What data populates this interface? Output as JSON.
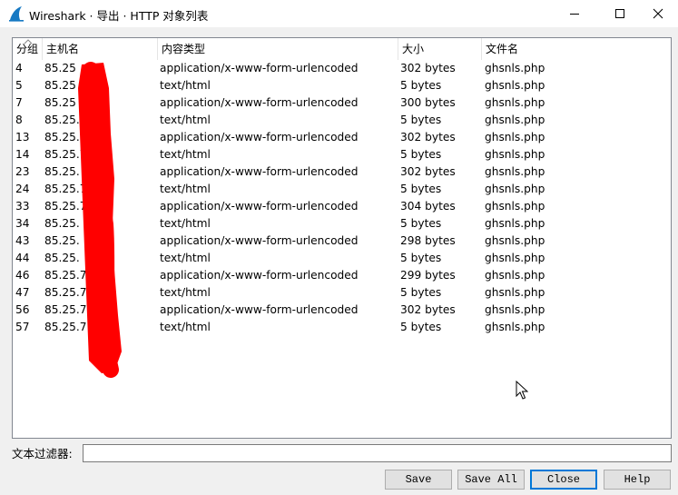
{
  "window": {
    "title": "Wireshark · 导出 · HTTP 对象列表",
    "icon": "wireshark-fin-icon",
    "controls": [
      "minimize-icon",
      "maximize-icon",
      "close-icon"
    ]
  },
  "table": {
    "columns": [
      "分组",
      "主机名",
      "内容类型",
      "大小",
      "文件名"
    ],
    "rows": [
      {
        "packet": "4",
        "host": "85.25",
        "content_type": "application/x-www-form-urlencoded",
        "size": "302 bytes",
        "filename": "ghsnls.php"
      },
      {
        "packet": "5",
        "host": "85.25",
        "content_type": "text/html",
        "size": "5 bytes",
        "filename": "ghsnls.php"
      },
      {
        "packet": "7",
        "host": "85.25",
        "content_type": "application/x-www-form-urlencoded",
        "size": "300 bytes",
        "filename": "ghsnls.php"
      },
      {
        "packet": "8",
        "host": "85.25.7",
        "content_type": "text/html",
        "size": "5 bytes",
        "filename": "ghsnls.php"
      },
      {
        "packet": "13",
        "host": "85.25.7",
        "content_type": "application/x-www-form-urlencoded",
        "size": "302 bytes",
        "filename": "ghsnls.php"
      },
      {
        "packet": "14",
        "host": "85.25.7",
        "content_type": "text/html",
        "size": "5 bytes",
        "filename": "ghsnls.php"
      },
      {
        "packet": "23",
        "host": "85.25.",
        "content_type": "application/x-www-form-urlencoded",
        "size": "302 bytes",
        "filename": "ghsnls.php"
      },
      {
        "packet": "24",
        "host": "85.25.7",
        "content_type": "text/html",
        "size": "5 bytes",
        "filename": "ghsnls.php"
      },
      {
        "packet": "33",
        "host": "85.25.7",
        "content_type": "application/x-www-form-urlencoded",
        "size": "304 bytes",
        "filename": "ghsnls.php"
      },
      {
        "packet": "34",
        "host": "85.25.",
        "content_type": "text/html",
        "size": "5 bytes",
        "filename": "ghsnls.php"
      },
      {
        "packet": "43",
        "host": "85.25.",
        "content_type": "application/x-www-form-urlencoded",
        "size": "298 bytes",
        "filename": "ghsnls.php"
      },
      {
        "packet": "44",
        "host": "85.25.",
        "content_type": "text/html",
        "size": "5 bytes",
        "filename": "ghsnls.php"
      },
      {
        "packet": "46",
        "host": "85.25.7",
        "content_type": "application/x-www-form-urlencoded",
        "size": "299 bytes",
        "filename": "ghsnls.php"
      },
      {
        "packet": "47",
        "host": "85.25.7",
        "content_type": "text/html",
        "size": "5 bytes",
        "filename": "ghsnls.php"
      },
      {
        "packet": "56",
        "host": "85.25.7",
        "content_type": "application/x-www-form-urlencoded",
        "size": "302 bytes",
        "filename": "ghsnls.php"
      },
      {
        "packet": "57",
        "host": "85.25.7",
        "content_type": "text/html",
        "size": "5 bytes",
        "filename": "ghsnls.php"
      }
    ],
    "redaction_color": "#ff0000"
  },
  "filter": {
    "label": "文本过滤器:",
    "value": "",
    "placeholder": ""
  },
  "buttons": {
    "save": "Save",
    "save_all": "Save All",
    "close": "Close",
    "help": "Help"
  },
  "colors": {
    "accent": "#0078d7",
    "wireshark_blue": "#1679c3"
  }
}
